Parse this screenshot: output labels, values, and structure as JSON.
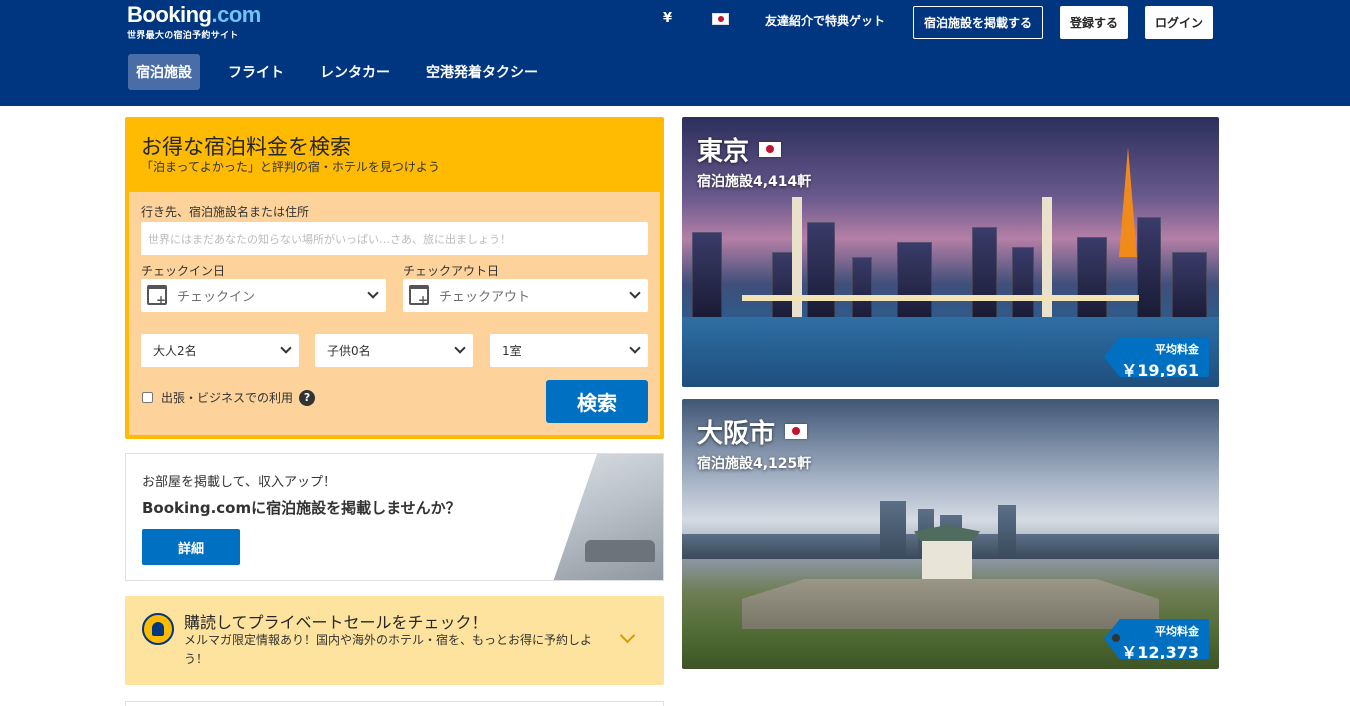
{
  "header": {
    "logo_brand": "Booking",
    "logo_dotcom": ".com",
    "logo_tagline": "世界最大の宿泊予約サイト",
    "currency": "¥",
    "referral": "友達紹介で特典ゲット",
    "list_property": "宿泊施設を掲載する",
    "register": "登録する",
    "login": "ログイン"
  },
  "nav": {
    "tabs": [
      {
        "label": "宿泊施設",
        "active": true
      },
      {
        "label": "フライト",
        "active": false
      },
      {
        "label": "レンタカー",
        "active": false
      },
      {
        "label": "空港発着タクシー",
        "active": false
      }
    ]
  },
  "search": {
    "title": "お得な宿泊料金を検索",
    "subtitle": "「泊まってよかった」と評判の宿・ホテルを見つけよう",
    "dest_label": "行き先、宿泊施設名または住所",
    "dest_placeholder": "世界にはまだあなたの知らない場所がいっぱい…さあ、旅に出ましょう！",
    "checkin_label": "チェックイン日",
    "checkin_placeholder": "チェックイン",
    "checkout_label": "チェックアウト日",
    "checkout_placeholder": "チェックアウト",
    "adults": "大人2名",
    "children": "子供0名",
    "rooms": "1室",
    "business_label": "出張・ビジネスでの利用",
    "help": "?",
    "search_button": "検索"
  },
  "promo": {
    "top": "お部屋を掲載して、収入アップ！",
    "title": "Booking.comに宿泊施設を掲載しませんか？",
    "button": "詳細"
  },
  "newsletter": {
    "title": "購読してプライベートセールをチェック！",
    "subtitle": "メルマガ限定情報あり！国内や海外のホテル・宿を、もっとお得に予約しよう！"
  },
  "cities": [
    {
      "name": "東京",
      "count": "宿泊施設4,414軒",
      "price_label": "平均料金",
      "price": "￥19,961"
    },
    {
      "name": "大阪市",
      "count": "宿泊施設4,125軒",
      "price_label": "平均料金",
      "price": "￥12,373"
    }
  ],
  "colors": {
    "header_bg": "#003580",
    "accent_yellow": "#febb02",
    "primary_blue": "#0071c2"
  }
}
